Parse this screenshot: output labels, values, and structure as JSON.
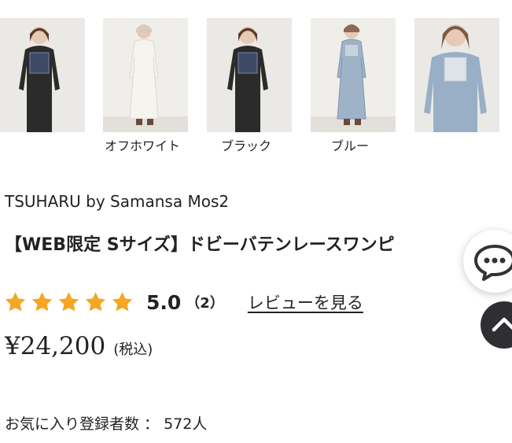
{
  "color_options": [
    {
      "label": ""
    },
    {
      "label": "オフホワイト"
    },
    {
      "label": "ブラック"
    },
    {
      "label": "ブルー"
    },
    {
      "label": ""
    }
  ],
  "product": {
    "brand": "TSUHARU by Samansa Mos2",
    "title": "【WEB限定 Sサイズ】ドビーバテンレースワンピ",
    "rating": {
      "stars": 5,
      "value": "5.0",
      "count": "（2）",
      "review_link": "レビューを見る"
    },
    "price": "¥24,200",
    "tax_note": "(税込)",
    "favorites": "お気に入り登録者数 ： 572人"
  },
  "icons": {
    "star": "star-icon",
    "chat": "chat-bubble-icon",
    "scroll_top": "chevron-up-icon"
  },
  "colors": {
    "star": "#f5a623",
    "scroll_top_bg": "#2f2f33",
    "text": "#222222"
  }
}
